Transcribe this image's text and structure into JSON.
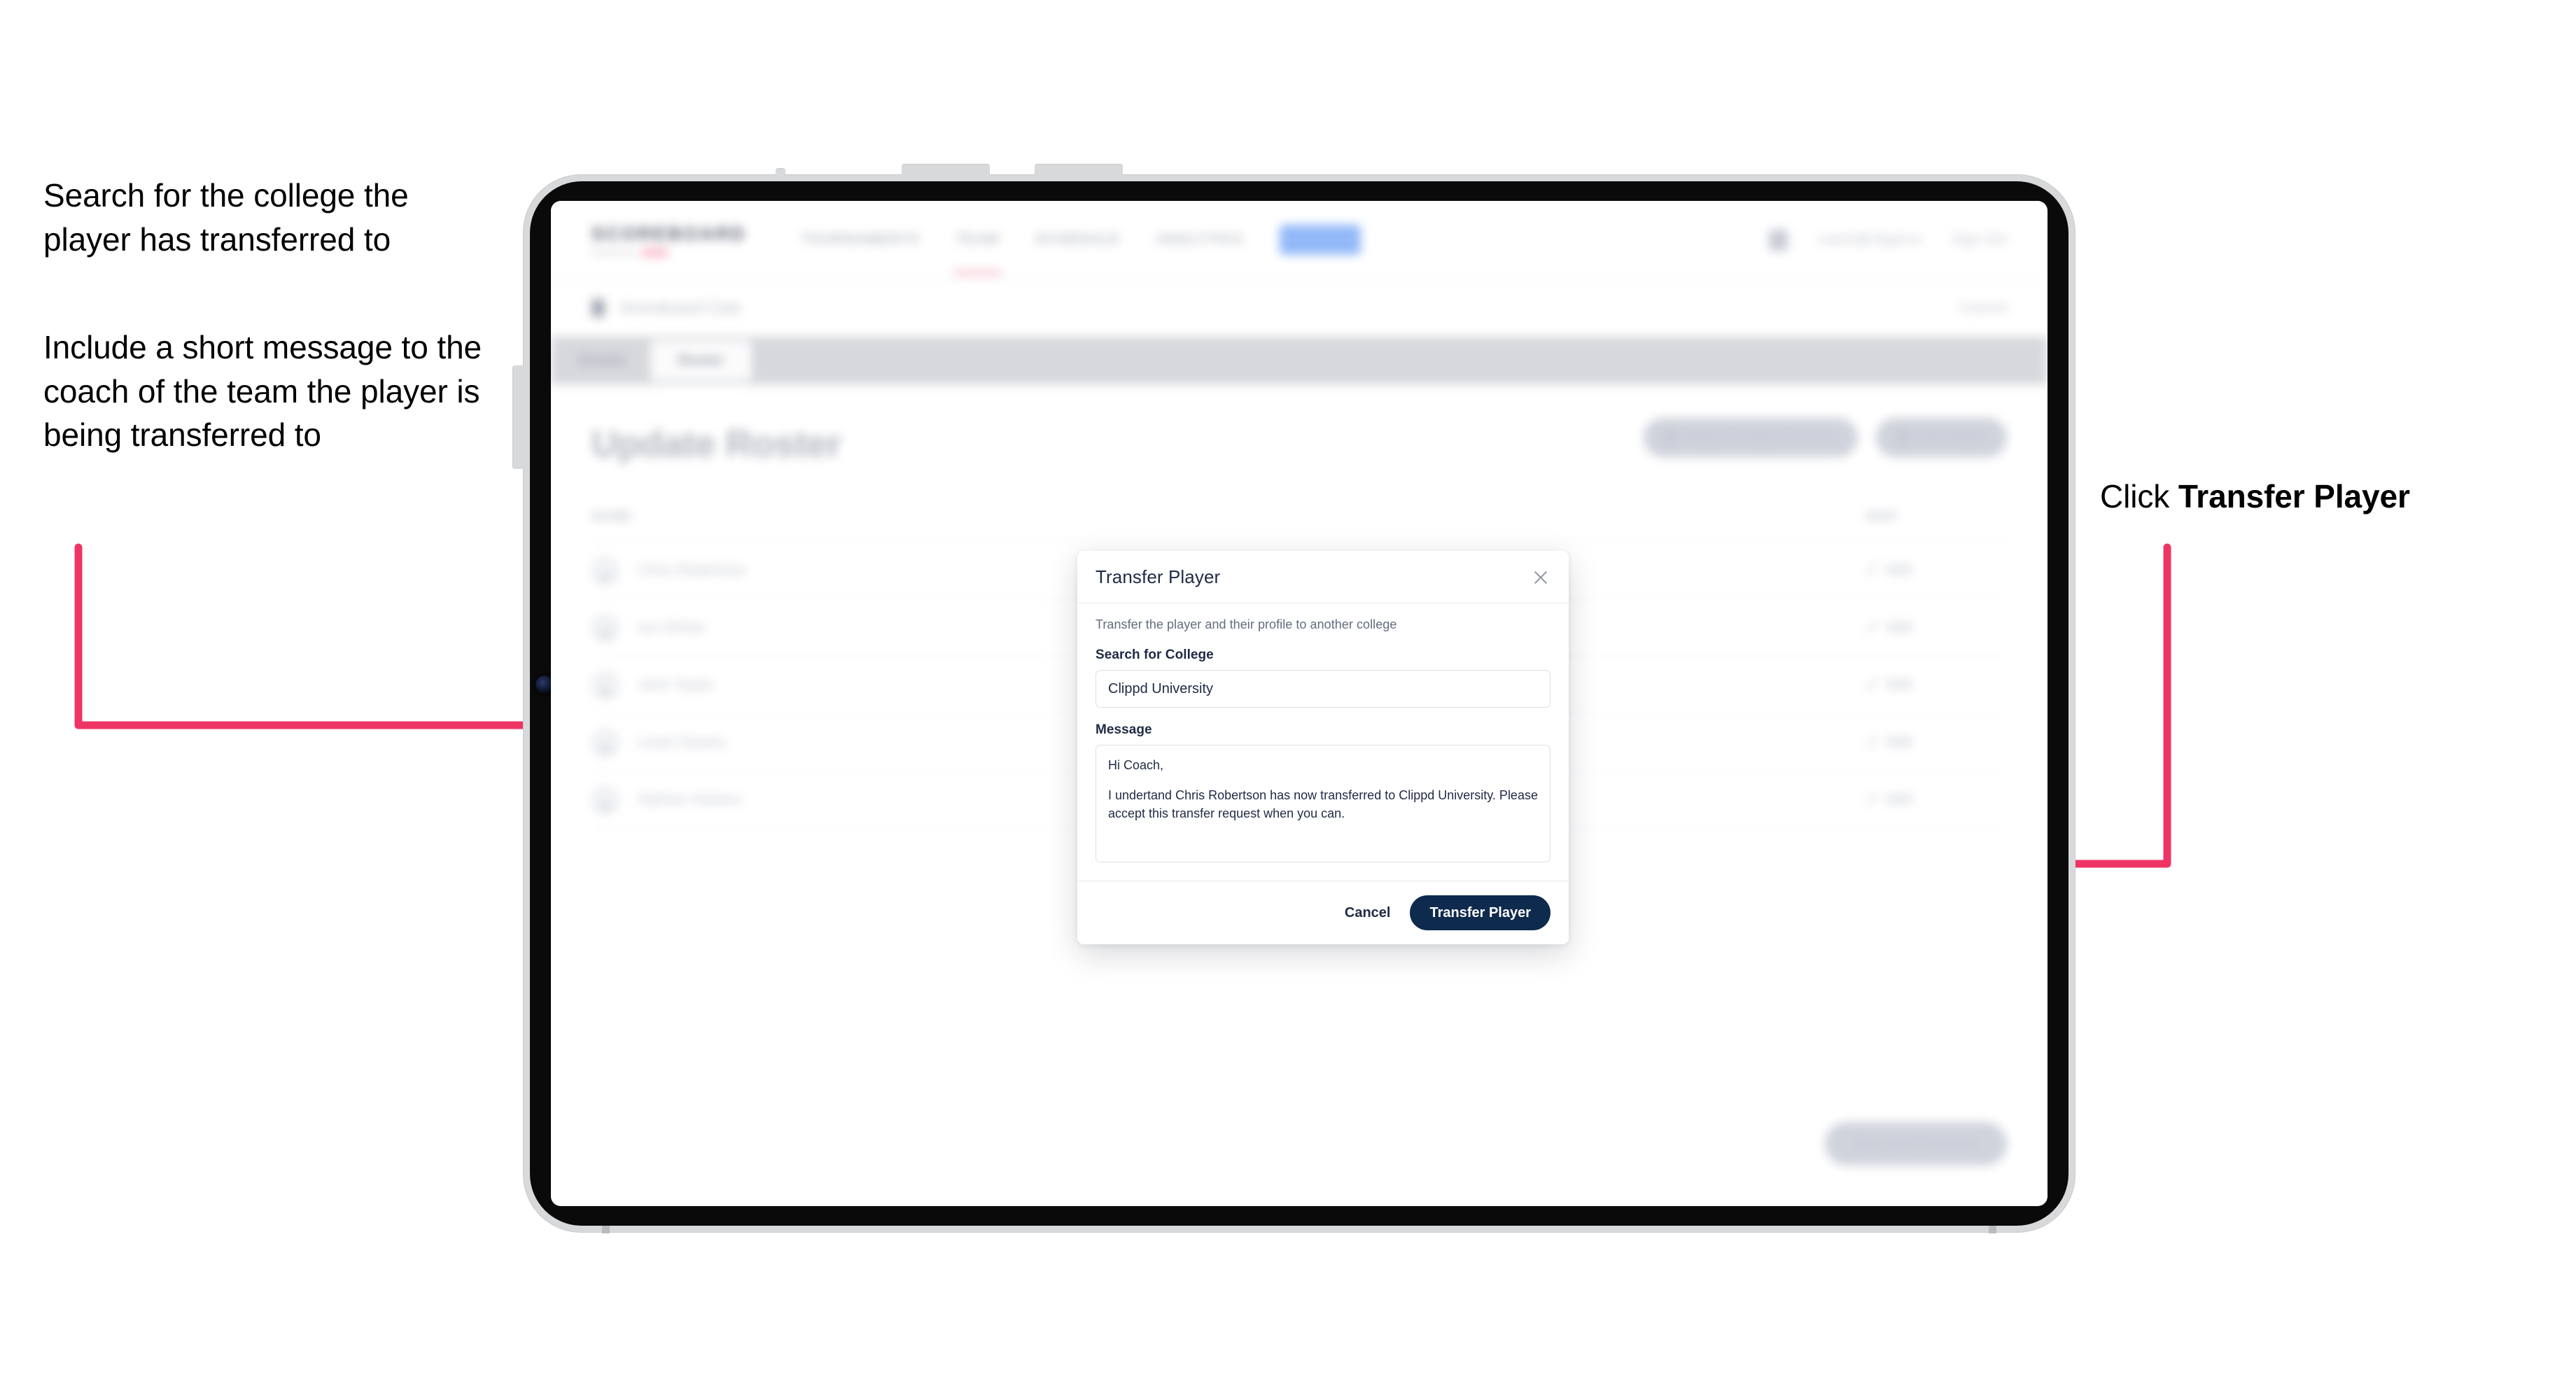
{
  "annotations": {
    "left_1": "Search for the college the player has transferred to",
    "left_2": "Include a short message to the coach of the team the player is being transferred to",
    "right_1_prefix": "Click ",
    "right_1_bold": "Transfer Player"
  },
  "colors": {
    "arrow": "#ee3465",
    "primary_button": "#0e2a4d",
    "device_frame": "#d8d9db",
    "device_bezel": "#0a0a0a"
  },
  "app": {
    "brand": {
      "name": "SCOREBOARD",
      "subtitle": "Powered by",
      "mark": "clippd"
    },
    "nav": [
      {
        "label": "TOURNAMENTS",
        "state": "normal"
      },
      {
        "label": "TEAM",
        "state": "underline"
      },
      {
        "label": "SCHEDULE",
        "state": "normal"
      },
      {
        "label": "ANALYTICS",
        "state": "normal"
      },
      {
        "label": "ADMIN",
        "state": "pill"
      }
    ],
    "nav_right": {
      "avatar": "user-avatar",
      "email": "coach@clippd.io",
      "signout": "Sign Out"
    },
    "breadcrumb": {
      "icon": "team-icon",
      "text": "Scoreboard Club",
      "right": "Cancel"
    },
    "tabs": [
      {
        "label": "Details",
        "active": false
      },
      {
        "label": "Roster",
        "active": true
      }
    ],
    "page_title": "Update Roster",
    "page_actions": [
      {
        "icon": "transfer-icon",
        "label": "Request Player Transfer"
      },
      {
        "icon": "plus-icon",
        "label": "Add Player"
      }
    ],
    "roster_columns": {
      "name": "NAME",
      "action": "EDIT"
    },
    "roster_rows": [
      {
        "name": "Chris Robertson",
        "action": "Edit"
      },
      {
        "name": "Ian Winter",
        "action": "Edit"
      },
      {
        "name": "John Taylor",
        "action": "Edit"
      },
      {
        "name": "Lewis Davies",
        "action": "Edit"
      },
      {
        "name": "Nathan Holmes",
        "action": "Edit"
      }
    ],
    "bottom_action": "Save and Continue"
  },
  "modal": {
    "title": "Transfer Player",
    "close_icon": "close-icon",
    "description": "Transfer the player and their profile to another college",
    "college_field": {
      "label": "Search for College",
      "value": "Clippd University"
    },
    "message_field": {
      "label": "Message",
      "line_1": "Hi Coach,",
      "line_2": "I undertand Chris Robertson has now transferred to Clippd University. Please accept this transfer request when you can."
    },
    "cancel_label": "Cancel",
    "submit_label": "Transfer Player"
  }
}
